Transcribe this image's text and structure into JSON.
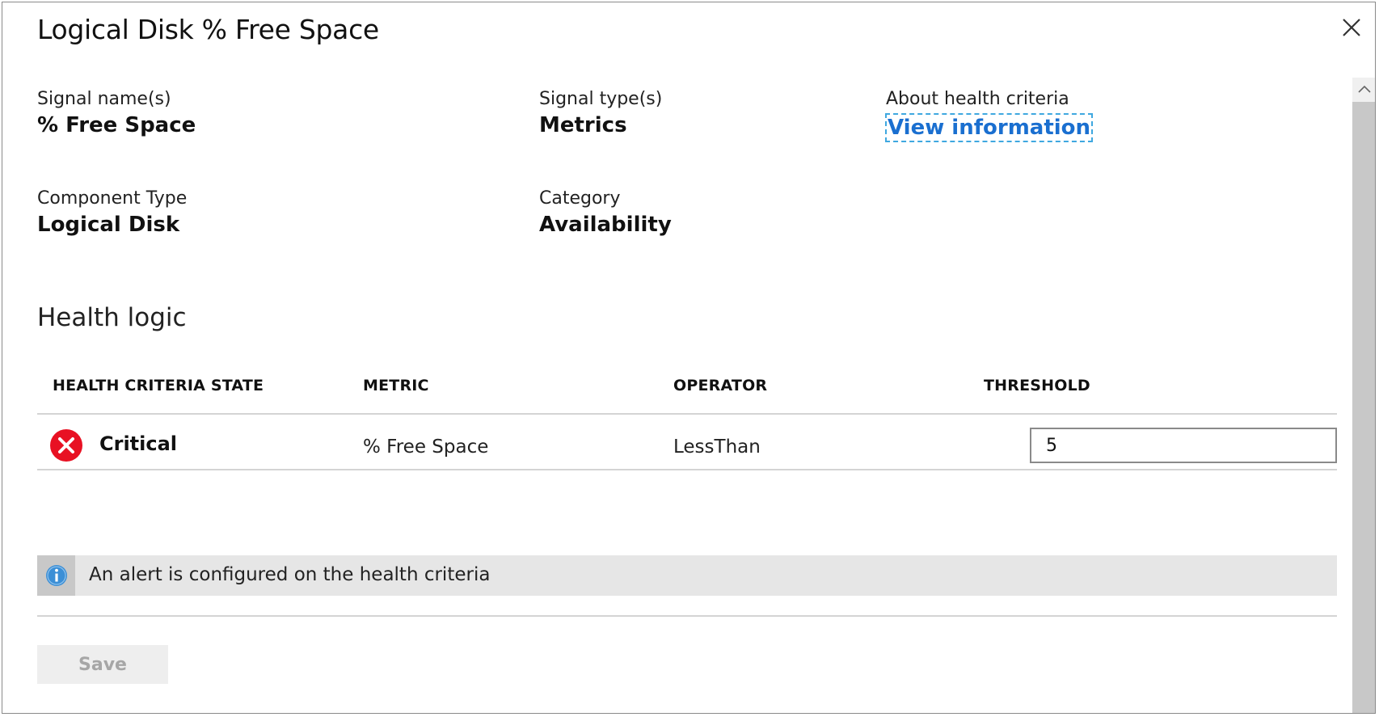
{
  "dialog": {
    "title": "Logical Disk % Free Space"
  },
  "details": {
    "signal_names_label": "Signal name(s)",
    "signal_names_value": "% Free Space",
    "signal_types_label": "Signal type(s)",
    "signal_types_value": "Metrics",
    "about_label": "About health criteria",
    "about_link": "View information",
    "component_type_label": "Component Type",
    "component_type_value": "Logical Disk",
    "category_label": "Category",
    "category_value": "Availability"
  },
  "health_logic": {
    "title": "Health logic",
    "columns": [
      "HEALTH CRITERIA STATE",
      "METRIC",
      "OPERATOR",
      "THRESHOLD"
    ],
    "rows": [
      {
        "state": "Critical",
        "state_icon": "error-circle-icon",
        "metric": "% Free Space",
        "operator": "LessThan",
        "threshold": "5"
      }
    ]
  },
  "info_bar": {
    "icon": "info-icon",
    "text": "An alert is configured on the health criteria"
  },
  "footer": {
    "save_label": "Save"
  },
  "colors": {
    "link": "#1a6fd0",
    "critical": "#e81123",
    "info_icon": "#3c8fd6",
    "info_bar_bg": "#e6e6e6",
    "save_disabled_text": "#a6a6a6"
  }
}
